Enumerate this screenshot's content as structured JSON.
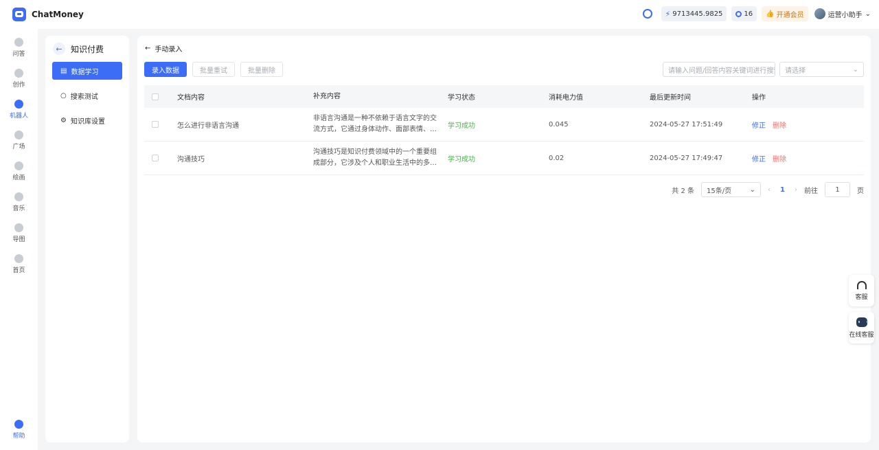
{
  "app": {
    "name": "ChatMoney"
  },
  "topbar": {
    "balance": "9713445.9825",
    "count": "16",
    "vip_label": "开通会员",
    "user_name": "运营小助手"
  },
  "leftnav": [
    {
      "label": "问答",
      "icon": "chat-icon"
    },
    {
      "label": "创作",
      "icon": "pen-icon"
    },
    {
      "label": "机器人",
      "icon": "robot-icon"
    },
    {
      "label": "广场",
      "icon": "grid-icon"
    },
    {
      "label": "绘画",
      "icon": "palette-icon"
    },
    {
      "label": "音乐",
      "icon": "music-icon"
    },
    {
      "label": "导图",
      "icon": "mindmap-icon"
    },
    {
      "label": "首页",
      "icon": "home-icon"
    }
  ],
  "help": {
    "label": "帮助"
  },
  "subpanel": {
    "title": "知识付费",
    "items": [
      {
        "label": "数据学习",
        "icon": "document-icon"
      },
      {
        "label": "搜索测试",
        "icon": "search-icon"
      },
      {
        "label": "知识库设置",
        "icon": "gear-icon"
      }
    ]
  },
  "main": {
    "breadcrumb": "手动录入",
    "toolbar": {
      "add": "录入数据",
      "retry": "批量重试",
      "delete": "批量删除"
    },
    "search_placeholder": "请输入问题/回答内容关键词进行搜索",
    "select_placeholder": "请选择",
    "columns": [
      "文档内容",
      "补充内容",
      "学习状态",
      "消耗电力值",
      "最后更新时间",
      "操作"
    ],
    "rows": [
      {
        "doc": "怎么进行非语言沟通",
        "extra": "非语言沟通是一种不依赖于语言文字的交流方式，它通过身体动作、面部表情、眼神交流等方式传递信息",
        "status": "学习成功",
        "cost": "0.045",
        "updated": "2024-05-27 17:51:49",
        "edit": "修正",
        "del": "删除"
      },
      {
        "doc": "沟通技巧",
        "extra": "沟通技巧是知识付费领域中的一个重要组成部分，它涉及个人和职业生活中的多个方面",
        "status": "学习成功",
        "cost": "0.02",
        "updated": "2024-05-27 17:49:47",
        "edit": "修正",
        "del": "删除"
      }
    ],
    "pager": {
      "total": "共 2 条",
      "size": "15条/页",
      "page": "1",
      "goto": "前往",
      "goto_value": "1",
      "suffix": "页"
    }
  },
  "float": {
    "service": "客服",
    "online": "在线客服"
  }
}
